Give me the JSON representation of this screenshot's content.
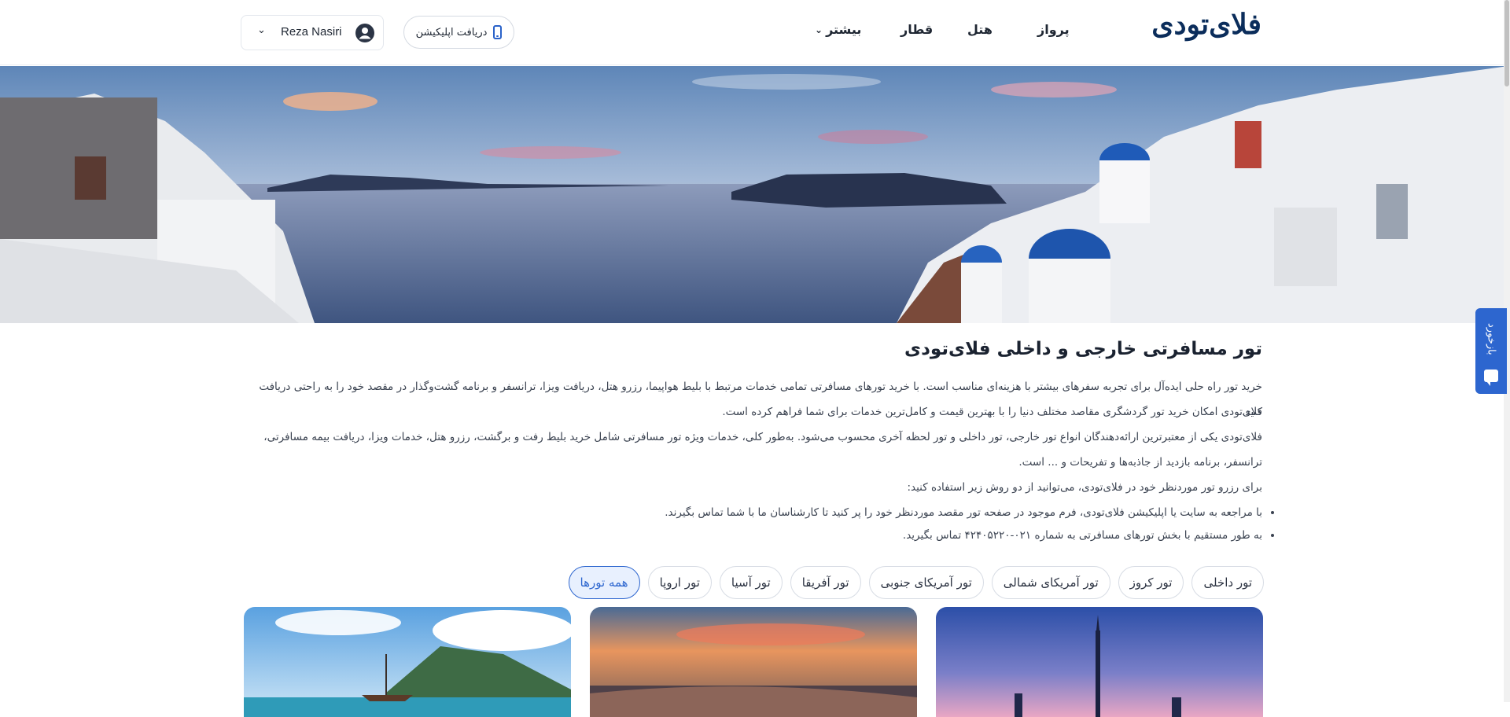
{
  "header": {
    "logo": "فلای‌تودی",
    "nav": {
      "flight": "پرواز",
      "hotel": "هتل",
      "train": "قطار",
      "more": "بیشتر"
    },
    "app_button": "دریافت اپلیکیشن",
    "user_name": "Reza Nasiri"
  },
  "feedback": {
    "label": "بازخورد"
  },
  "main": {
    "title": "تور مسافرتی خارجی و داخلی فلای‌تودی",
    "paragraphs": [
      "خرید تور راه حلی ایده‌آل برای تجربه سفرهای بیشتر با هزینه‌ای مناسب است. با خرید تورهای مسافرتی تمامی خدمات مرتبط با بلیط هواپیما، رزرو هتل، دریافت ویزا، ترانسفر و برنامه گشت‌وگذار در مقصد خود را به راحتی دریافت کنید.",
      "فلای‌تودی امکان خرید تور گردشگری مقاصد مختلف دنیا را با بهترین قیمت و کامل‌ترین خدمات برای شما فراهم کرده است.",
      "فلای‌تودی یکی از معتبرترین ارائه‌دهندگان انواع تور خارجی، تور داخلی و تور لحظه آخری محسوب می‌شود. به‌طور کلی، خدمات ویژه تور مسافرتی شامل خرید بلیط رفت و برگشت، رزرو هتل، خدمات ویزا، دریافت بیمه مسافرتی، ترانسفر، برنامه بازدید از جاذبه‌ها و تفریحات و ... است.",
      "برای رزرو تور موردنظر خود در فلای‌تودی، می‌توانید از دو روش زیر استفاده کنید:"
    ],
    "bullets": [
      "با مراجعه به سایت یا اپلیکیشن فلای‌تودی، فرم موجود در صفحه تور مقصد موردنظر خود را پر کنید تا کارشناسان ما با شما تماس بگیرند.",
      "به طور مستقیم با بخش تورهای مسافرتی به شماره ۰۲۱-۴۲۴۰۵۲۲۰ تماس بگیرید."
    ]
  },
  "filters": [
    "همه تورها",
    "تور اروپا",
    "تور آسیا",
    "تور آفریقا",
    "تور آمریکای جنوبی",
    "تور آمریکای شمالی",
    "تور کروز",
    "تور داخلی"
  ],
  "colors": {
    "brand_navy": "#0b2d5b",
    "accent_blue": "#2d66cf",
    "active_chip_bg": "#e8f0fe"
  }
}
